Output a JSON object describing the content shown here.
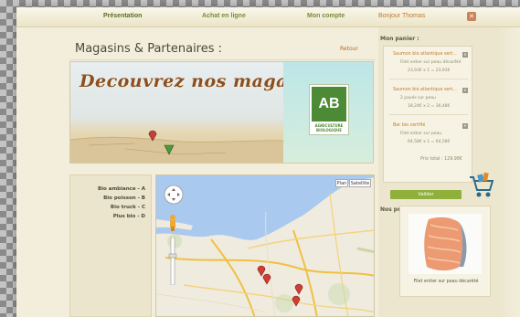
{
  "nav": {
    "items": [
      "Présentation",
      "Achat en ligne",
      "Mon compte"
    ],
    "greeting": "Bonjour Thomas",
    "close": "✕"
  },
  "page": {
    "title": "Magasins & Partenaires :",
    "back_link": "Retour"
  },
  "banner": {
    "headline": "Decouvrez nos magasins",
    "logo_letters": "AB",
    "logo_caption": "AGRICULTURE BIOLOGIQUE"
  },
  "shops": [
    "Bio ambiance - A",
    "Bio poisson - B",
    "Bio truck - C",
    "Plus bio - D"
  ],
  "map": {
    "button_plan": "Plan",
    "button_satellite": "Satellite"
  },
  "cart": {
    "heading": "Mon panier :",
    "items": [
      {
        "name": "Saumon bio atlantique sert...",
        "desc": "Filet entier sur peau décarêté",
        "price": "23,93€ x 1 = 23,93€"
      },
      {
        "name": "Saumon bio atlantique sert...",
        "desc": "2 pavés sur peau",
        "price": "18,24€ x 2 = 36,48€"
      },
      {
        "name": "Bar bio certifié",
        "desc": "Filet entier sur peau",
        "price": "64,58€ x 1 = 64,58€"
      }
    ],
    "total": "Prix total : 129,98€",
    "validate": "Valider",
    "remove": "✕"
  },
  "products": {
    "heading": "Nos produits :",
    "item_name": "Filet entier sur peau décarêté"
  },
  "colors": {
    "accent": "#8fb03a",
    "link": "#c07a2a",
    "brand_green": "#4c8a35"
  }
}
